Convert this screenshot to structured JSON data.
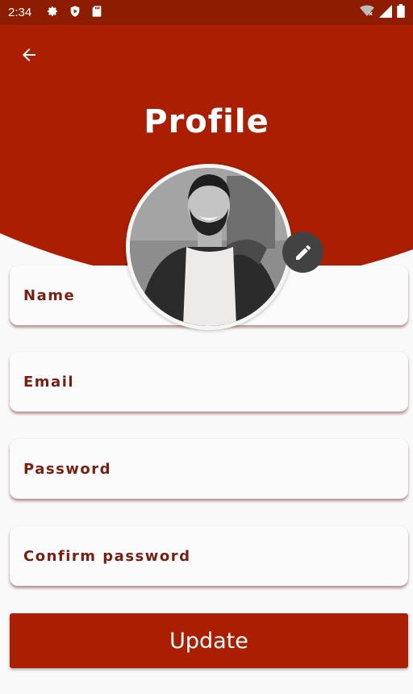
{
  "status_bar": {
    "time": "2:34",
    "icons_left": [
      "settings-icon",
      "shield-play-icon",
      "sd-card-icon"
    ],
    "icons_right": [
      "wifi-off-icon",
      "cell-signal-icon",
      "battery-icon"
    ]
  },
  "header": {
    "title": "Profile",
    "background_color": "#ab1e02",
    "status_color": "#8e1c00"
  },
  "avatar": {
    "description_icon": "profile-photo",
    "edit_icon": "pencil-icon"
  },
  "form": {
    "fields": [
      {
        "label": "Name"
      },
      {
        "label": "Email"
      },
      {
        "label": "Password"
      },
      {
        "label": "Confirm password"
      }
    ]
  },
  "actions": {
    "update_label": "Update"
  }
}
